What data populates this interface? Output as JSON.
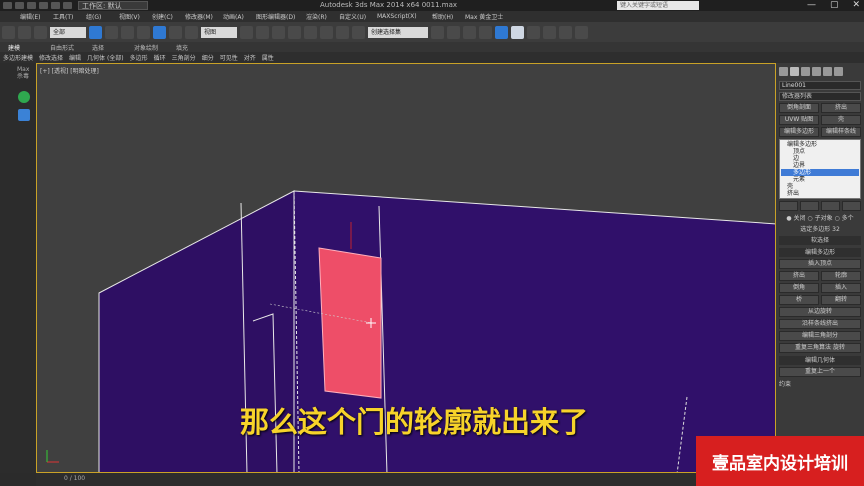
{
  "titlebar": {
    "workspace": "工作区: 默认",
    "app_title": "Autodesk 3ds Max  2014 x64     0011.max",
    "search_placeholder": "键入关键字或短语",
    "window_controls": [
      "—",
      "▢",
      "✕"
    ]
  },
  "menubar": {
    "items": [
      "编辑(E)",
      "工具(T)",
      "组(G)",
      "视图(V)",
      "创建(C)",
      "修改器(M)",
      "动画(A)",
      "图形编辑器(D)",
      "渲染(R)",
      "自定义(U)",
      "MAXScript(X)",
      "帮助(H)",
      "Max 黄金卫士"
    ]
  },
  "toolbar": {
    "selection_filter": "全部",
    "view_dropdown": "视图",
    "named_selection": "创建选择集"
  },
  "ribbon": {
    "tabs": [
      "建模",
      "自由形式",
      "选择",
      "对象绘制",
      "填充"
    ],
    "sub_items": [
      "多边形建模",
      "修改选择",
      "编辑",
      "几何体 (全部)",
      "多边形",
      "循环",
      "三角剖分",
      "细分",
      "可见性",
      "对齐",
      "属性"
    ]
  },
  "leftbar": {
    "label": "Max 杀毒"
  },
  "viewport": {
    "label": "[+] [透视] [明暗处理]"
  },
  "rightpanel": {
    "object_name": "Line001",
    "modifier_list": "修改器列表",
    "buttons_row1": [
      "倒角剖面",
      "挤出"
    ],
    "buttons_row2": [
      "UVW 贴图",
      "壳"
    ],
    "buttons_row3": [
      "编辑多边形",
      "编辑样条线"
    ],
    "stack_items": [
      "编辑多边形",
      "顶点",
      "边",
      "边界",
      "多边形",
      "元素",
      "壳",
      "挤出"
    ],
    "selected_stack_item": "多边形",
    "section1_options": [
      "● 关闭",
      "○ 子对象",
      "○ 多个"
    ],
    "section1_text": "选定多边形 32",
    "section_soft": "软选择",
    "section_edit_poly": "编辑多边形",
    "insert_vertex": "插入顶点",
    "edit_rows": [
      [
        "挤出",
        "轮廓"
      ],
      [
        "倒角",
        "插入"
      ],
      [
        "桥",
        "翻转"
      ]
    ],
    "single_buttons": [
      "从边旋转",
      "沿样条线挤出",
      "编辑三角剖分",
      "重复三角算法  旋转"
    ],
    "section_edit_geom": "编辑几何体",
    "repeat_last": "重复上一个",
    "constraint": "约束"
  },
  "statusbar": {
    "frame": "0 / 100"
  },
  "overlay": {
    "subtitle": "那么这个门的轮廓就出来了",
    "brand": "壹品室内设计培训"
  },
  "colors": {
    "viewport_bg": "#404040",
    "wall_fill": "#2e0f63",
    "door_fill": "#ee4e68",
    "subtitle": "#f7d32a",
    "brand_bg": "#d71f1f",
    "selection_blue": "#3f7bd6"
  }
}
